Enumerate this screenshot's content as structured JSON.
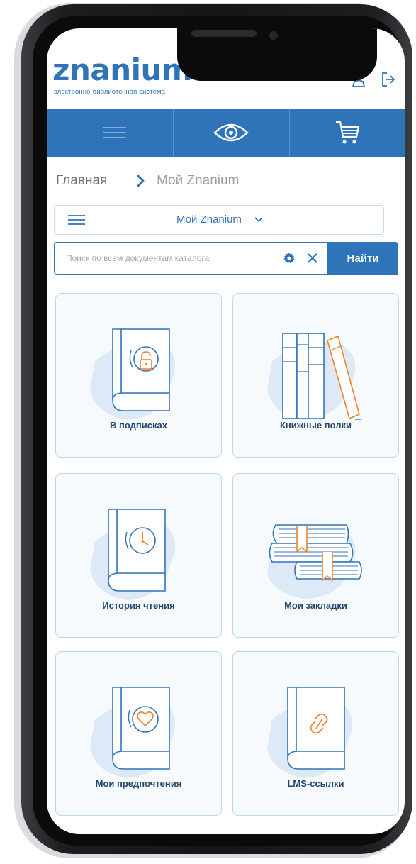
{
  "app": {
    "logo_text": "znanium",
    "logo_subtitle": "электронно-библиотечная система"
  },
  "header": {
    "icons": [
      "user-icon",
      "logout-icon"
    ]
  },
  "navbar": {
    "icons": [
      "hamburger-menu-icon",
      "eye-icon",
      "cart-icon"
    ],
    "colors": {
      "background": "#2f74b9"
    }
  },
  "breadcrumb": {
    "home": "Главная",
    "current": "Мой Znanium"
  },
  "section_select": {
    "selected": "Мой Znanium"
  },
  "search": {
    "placeholder": "Поиск по всем документам каталога",
    "value": "",
    "button_label": "Найти"
  },
  "tiles": [
    {
      "label": "В подписках",
      "icon": "book-lock-icon"
    },
    {
      "label": "Книжные полки",
      "icon": "bookshelf-icon"
    },
    {
      "label": "История чтения",
      "icon": "book-clock-icon"
    },
    {
      "label": "Мои закладки",
      "icon": "bookmarks-icon"
    },
    {
      "label": "Мои предпочтения",
      "icon": "book-heart-icon"
    },
    {
      "label": "LMS-ссылки",
      "icon": "book-link-icon"
    }
  ],
  "colors": {
    "primary": "#2f74b9",
    "accent": "#f0832a",
    "tile_border": "#bcd6ee"
  }
}
